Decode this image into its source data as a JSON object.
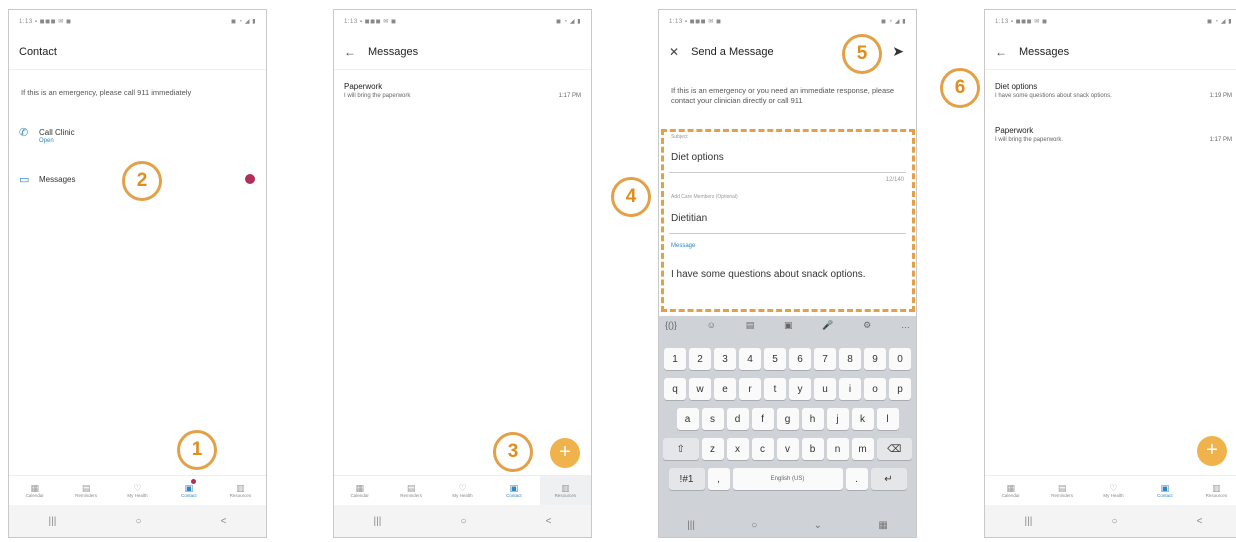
{
  "status_text": "1:13 ▪ ◼◼◼ ✉ ◼",
  "status_right": "◼ ◔ ◢ ▮",
  "tabs": [
    "Calendar",
    "Reminders",
    "My Health",
    "Contact",
    "Resources"
  ],
  "sysnav": [
    "|||",
    "○",
    "<"
  ],
  "screen1": {
    "title": "Contact",
    "emergency": "If this is an emergency, please call 911 immediately",
    "call_clinic": "Call Clinic",
    "call_status": "Open",
    "messages": "Messages"
  },
  "screen2": {
    "title": "Messages",
    "items": [
      {
        "subject": "Paperwork",
        "preview": "I will bring the paperwork",
        "time": "1:17 PM"
      }
    ]
  },
  "screen3": {
    "title": "Send a Message",
    "emergency": "If this is an emergency or you need an immediate response, please contact your clinician directly or call 911",
    "subject_label": "Subject",
    "subject_value": "Diet options",
    "counter": "12/140",
    "care_label": "Add Care Members (Optional)",
    "care_value": "Dietitian",
    "message_label": "Message",
    "message_value": "I have some questions about snack options.",
    "kb_tools": [
      "{()}",
      "☺",
      "▤",
      "▣",
      "🎤",
      "⚙",
      "…"
    ],
    "kb_numbers": [
      "1",
      "2",
      "3",
      "4",
      "5",
      "6",
      "7",
      "8",
      "9",
      "0"
    ],
    "kb_row1": [
      "q",
      "w",
      "e",
      "r",
      "t",
      "y",
      "u",
      "i",
      "o",
      "p"
    ],
    "kb_row2": [
      "a",
      "s",
      "d",
      "f",
      "g",
      "h",
      "j",
      "k",
      "l"
    ],
    "kb_row3": [
      "⇧",
      "z",
      "x",
      "c",
      "v",
      "b",
      "n",
      "m",
      "⌫"
    ],
    "kb_row4": [
      "!#1",
      ",",
      "English (US)",
      ".",
      "↵"
    ],
    "kb_sys": [
      "|||",
      "○",
      "⌄",
      "▦"
    ]
  },
  "screen4": {
    "title": "Messages",
    "items": [
      {
        "subject": "Diet options",
        "preview": "I have some questions about snack options.",
        "time": "1:19 PM"
      },
      {
        "subject": "Paperwork",
        "preview": "I will bring the paperwork.",
        "time": "1:17 PM"
      }
    ]
  },
  "callouts": [
    "1",
    "2",
    "3",
    "4",
    "5",
    "6"
  ],
  "fab_label": "+",
  "colors": {
    "accent": "#2f86c4",
    "callout": "#e3a047",
    "fab": "#f0b24a",
    "badge": "#b0305a"
  }
}
